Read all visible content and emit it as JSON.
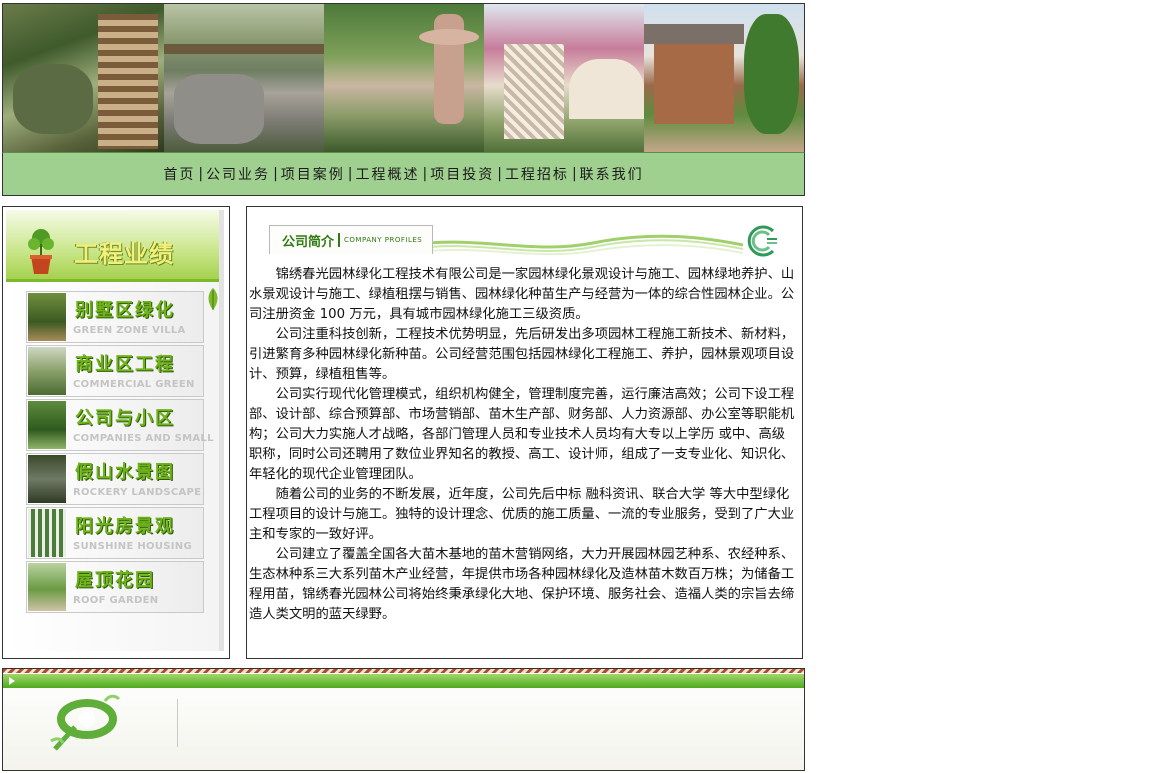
{
  "nav": {
    "items": [
      "首页",
      "公司业务",
      "项目案例",
      "工程概述",
      "项目投资",
      "工程招标",
      "联系我们"
    ],
    "separator": "|"
  },
  "sidebar": {
    "title": "工程业绩",
    "categories": [
      {
        "zh": "别墅区绿化",
        "en": "GREEN ZONE VILLA"
      },
      {
        "zh": "商业区工程",
        "en": "COMMERCIAL GREEN"
      },
      {
        "zh": "公司与小区",
        "en": "COMPANIES AND SMALL"
      },
      {
        "zh": "假山水景图",
        "en": "ROCKERY LANDSCAPE"
      },
      {
        "zh": "阳光房景观",
        "en": "SUNSHINE HOUSING"
      },
      {
        "zh": "屋顶花园",
        "en": "ROOF GARDEN"
      }
    ]
  },
  "main": {
    "tab_title": "公司简介",
    "tab_subtitle": "COMPANY PROFILES",
    "paragraphs": [
      "锦绣春光园林绿化工程技术有限公司是一家园林绿化景观设计与施工、园林绿地养护、山水景观设计与施工、绿植租摆与销售、园林绿化种苗生产与经营为一体的综合性园林企业。公司注册资金 100 万元，具有城市园林绿化施工三级资质。",
      "公司注重科技创新，工程技术优势明显，先后研发出多项园林工程施工新技术、新材料，引进繁育多种园林绿化新种苗。公司经营范围包括园林绿化工程施工、养护，园林景观项目设计、预算，绿植租售等。",
      "公司实行现代化管理模式，组织机构健全，管理制度完善，运行廉洁高效；公司下设工程部、设计部、综合预算部、市场营销部、苗木生产部、财务部、人力资源部、办公室等职能机构；公司大力实施人才战略，各部门管理人员和专业技术人员均有大专以上学历 或中、高级职称，同时公司还聘用了数位业界知名的教授、高工、设计师，组成了一支专业化、知识化、年轻化的现代企业管理团队。",
      " 随着公司的业务的不断发展，近年度，公司先后中标 融科资讯、联合大学 等大中型绿化工程项目的设计与施工。独特的设计理念、优质的施工质量、一流的专业服务，受到了广大业主和专家的一致好评。",
      "公司建立了覆盖全国各大苗木基地的苗木营销网络，大力开展园林园艺种系、农经种系、生态林种系三大系列苗木产业经营，年提供市场各种园林绿化及造林苗木数百万株；为储备工程用苗，锦绣春光园林公司将始终秉承绿化大地、保护环境、服务社会、造福人类的宗旨去缔造人类文明的蓝天绿野。"
    ]
  },
  "colors": {
    "nav_bg": "#9fd08f",
    "accent_green": "#6fb31a",
    "title_yellow": "#f4f080"
  },
  "icons": {
    "potted_plant": "potted-plant-icon",
    "company_logo": "company-logo-icon",
    "footer_logo": "footer-logo-icon"
  }
}
